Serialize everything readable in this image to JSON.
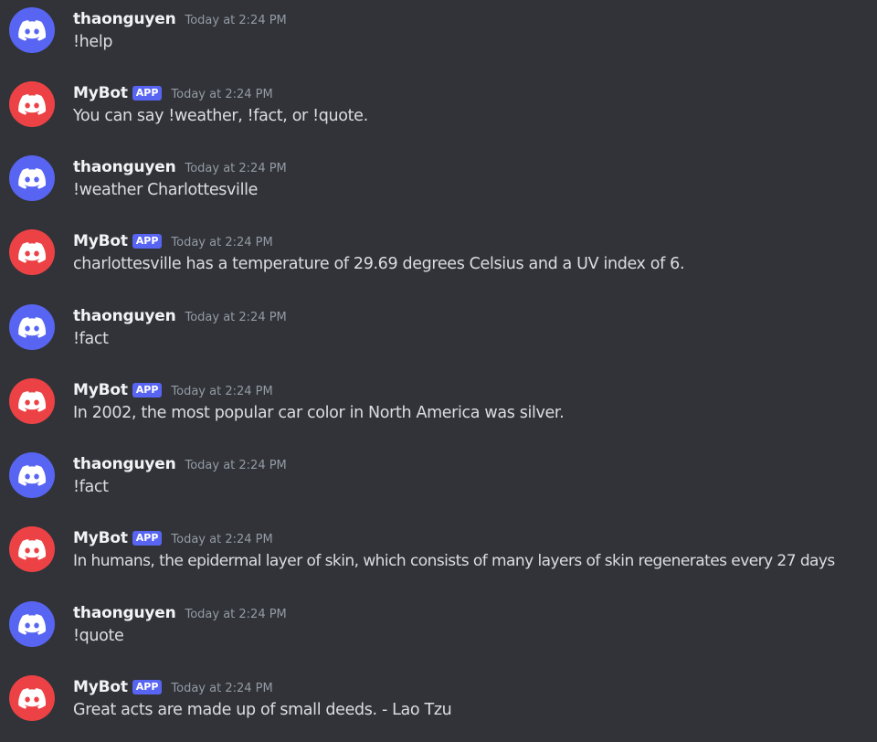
{
  "colors": {
    "background": "#313338",
    "user_avatar": "#5865f2",
    "bot_avatar": "#ed4245",
    "app_tag": "#5865f2",
    "timestamp": "#949ba4",
    "text": "#dbdee1"
  },
  "messages": [
    {
      "author": "thaonguyen",
      "is_bot": false,
      "time": "Today at 2:24 PM",
      "text": "!help",
      "avatar_icon": "discord-logo-icon"
    },
    {
      "author": "MyBot",
      "is_bot": true,
      "tag": "APP",
      "time": "Today at 2:24 PM",
      "text": "You can say !weather, !fact, or !quote.",
      "avatar_icon": "discord-logo-icon"
    },
    {
      "author": "thaonguyen",
      "is_bot": false,
      "time": "Today at 2:24 PM",
      "text": "!weather Charlottesville",
      "avatar_icon": "discord-logo-icon"
    },
    {
      "author": "MyBot",
      "is_bot": true,
      "tag": "APP",
      "time": "Today at 2:24 PM",
      "text": "charlottesville has a temperature of 29.69 degrees Celsius and a UV index of 6.",
      "avatar_icon": "discord-logo-icon"
    },
    {
      "author": "thaonguyen",
      "is_bot": false,
      "time": "Today at 2:24 PM",
      "text": "!fact",
      "avatar_icon": "discord-logo-icon"
    },
    {
      "author": "MyBot",
      "is_bot": true,
      "tag": "APP",
      "time": "Today at 2:24 PM",
      "text": "In 2002, the most popular car color in North America was silver.",
      "avatar_icon": "discord-logo-icon"
    },
    {
      "author": "thaonguyen",
      "is_bot": false,
      "time": "Today at 2:24 PM",
      "text": "!fact",
      "avatar_icon": "discord-logo-icon"
    },
    {
      "author": "MyBot",
      "is_bot": true,
      "tag": "APP",
      "time": "Today at 2:24 PM",
      "text": "In humans, the epidermal layer of skin, which consists of many layers of skin regenerates every 27 days",
      "avatar_icon": "discord-logo-icon"
    },
    {
      "author": "thaonguyen",
      "is_bot": false,
      "time": "Today at 2:24 PM",
      "text": "!quote",
      "avatar_icon": "discord-logo-icon"
    },
    {
      "author": "MyBot",
      "is_bot": true,
      "tag": "APP",
      "time": "Today at 2:24 PM",
      "text": "Great acts are made up of small deeds. - Lao Tzu",
      "avatar_icon": "discord-logo-icon"
    }
  ]
}
